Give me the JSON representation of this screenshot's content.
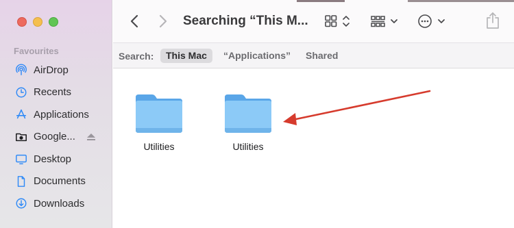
{
  "window": {
    "title": "Searching “This M...",
    "accent_color": "#2f8af7",
    "annotation_arrow_color": "#d63b2d"
  },
  "sidebar": {
    "section_title": "Favourites",
    "items": [
      {
        "label": "AirDrop",
        "icon": "airdrop-icon"
      },
      {
        "label": "Recents",
        "icon": "clock-icon"
      },
      {
        "label": "Applications",
        "icon": "applications-icon"
      },
      {
        "label": "Google...",
        "icon": "drive-icon"
      },
      {
        "label": "Desktop",
        "icon": "desktop-icon"
      },
      {
        "label": "Documents",
        "icon": "document-icon"
      },
      {
        "label": "Downloads",
        "icon": "download-icon"
      }
    ]
  },
  "scopebar": {
    "label": "Search:",
    "scopes": [
      {
        "label": "This Mac",
        "active": true
      },
      {
        "label": "“Applications”",
        "active": false
      },
      {
        "label": "Shared",
        "active": false
      }
    ]
  },
  "content": {
    "items": [
      {
        "label": "Utilities",
        "icon": "folder-icon"
      },
      {
        "label": "Utilities",
        "icon": "folder-icon"
      }
    ]
  }
}
